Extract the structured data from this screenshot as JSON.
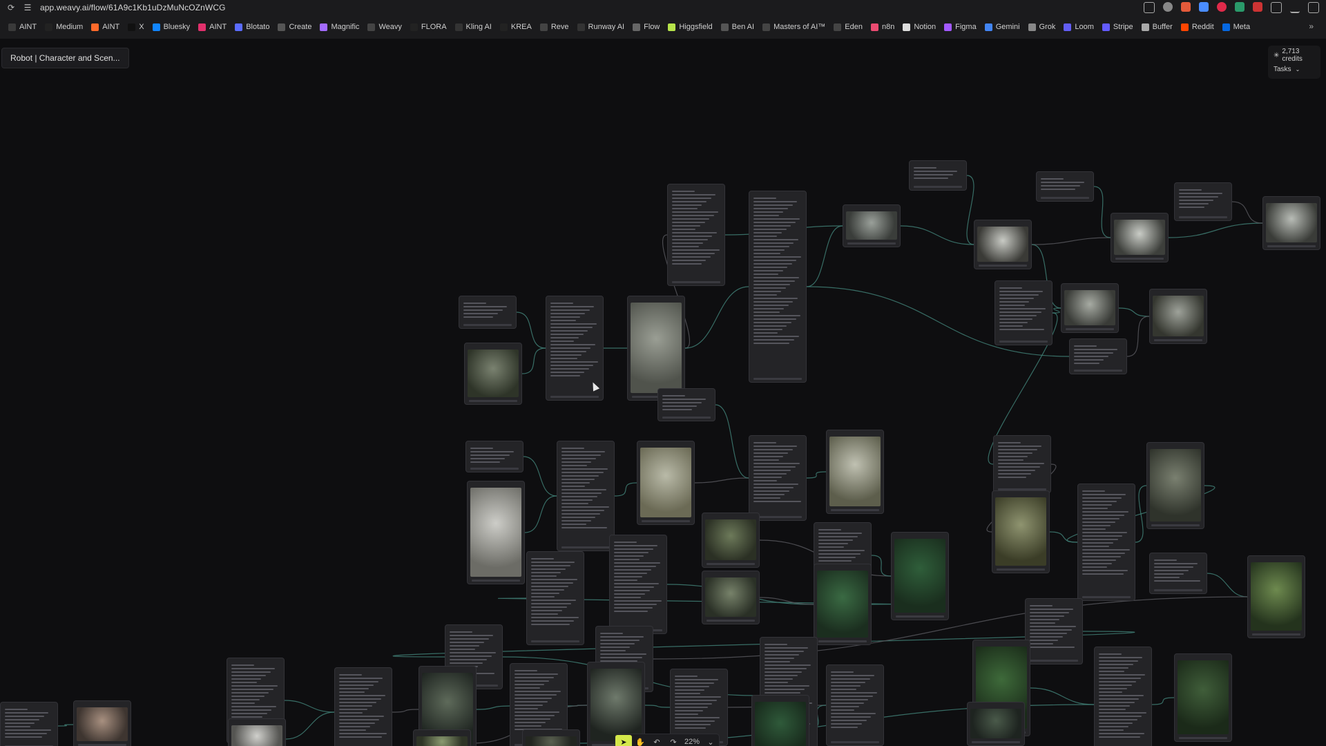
{
  "browser": {
    "url": "app.weavy.ai/flow/61A9c1Kb1uDzMuNcOZnWCG",
    "bookmarks": [
      {
        "label": "AINT",
        "color": "#3a3a3a"
      },
      {
        "label": "Medium",
        "color": "#222"
      },
      {
        "label": "AINT",
        "color": "#ff6a2a"
      },
      {
        "label": "X",
        "color": "#111"
      },
      {
        "label": "Bluesky",
        "color": "#1185fe"
      },
      {
        "label": "AINT",
        "color": "#e1306c"
      },
      {
        "label": "Blotato",
        "color": "#5b6cff"
      },
      {
        "label": "Create",
        "color": "#555"
      },
      {
        "label": "Magnific",
        "color": "#a36bff"
      },
      {
        "label": "Weavy",
        "color": "#444"
      },
      {
        "label": "FLORA",
        "color": "#222"
      },
      {
        "label": "Kling AI",
        "color": "#333"
      },
      {
        "label": "KREA",
        "color": "#222"
      },
      {
        "label": "Reve",
        "color": "#444"
      },
      {
        "label": "Runway AI",
        "color": "#333"
      },
      {
        "label": "Flow",
        "color": "#666"
      },
      {
        "label": "Higgsfield",
        "color": "#b6e34a"
      },
      {
        "label": "Ben AI",
        "color": "#555"
      },
      {
        "label": "Masters of AI™",
        "color": "#444"
      },
      {
        "label": "Eden",
        "color": "#444"
      },
      {
        "label": "n8n",
        "color": "#ea4b71"
      },
      {
        "label": "Notion",
        "color": "#ddd"
      },
      {
        "label": "Figma",
        "color": "#a259ff"
      },
      {
        "label": "Gemini",
        "color": "#4285f4"
      },
      {
        "label": "Grok",
        "color": "#888"
      },
      {
        "label": "Loom",
        "color": "#625df5"
      },
      {
        "label": "Stripe",
        "color": "#635bff"
      },
      {
        "label": "Buffer",
        "color": "#aaa"
      },
      {
        "label": "Reddit",
        "color": "#ff4500"
      },
      {
        "label": "Meta",
        "color": "#0668e1"
      }
    ],
    "more_label": "»"
  },
  "flow": {
    "title": "Robot | Character and Scen...",
    "credits": "2,713 credits",
    "tasks_label": "Tasks",
    "zoom": "22%"
  },
  "colors": {
    "accent": "#d4e84a",
    "edge": "#3f7e74",
    "edge_gray": "#56565c"
  }
}
